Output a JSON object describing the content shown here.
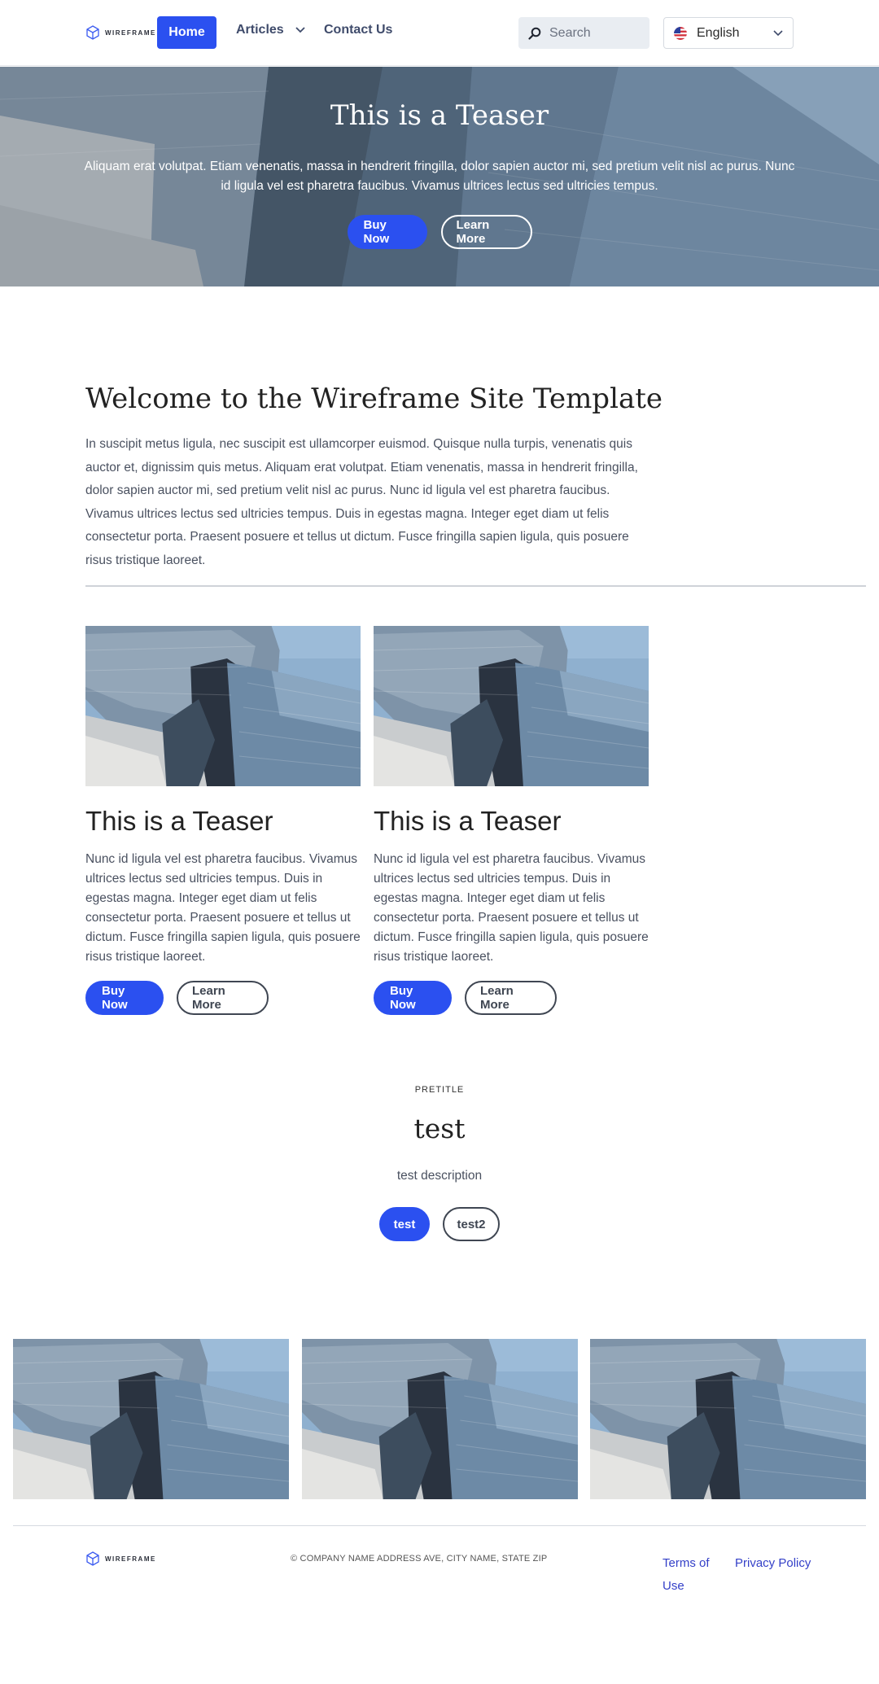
{
  "header": {
    "logo_text": "WIREFRAME",
    "nav": {
      "home": "Home",
      "articles": "Articles",
      "contact": "Contact Us"
    },
    "search_placeholder": "Search",
    "language": "English"
  },
  "hero": {
    "title": "This is a Teaser",
    "text": "Aliquam erat volutpat. Etiam venenatis, massa in hendrerit fringilla, dolor sapien auctor mi, sed pretium velit nisl ac purus. Nunc id ligula vel est pharetra faucibus. Vivamus ultrices lectus sed ultricies tempus.",
    "primary_button": "Buy Now",
    "secondary_button": "Learn More"
  },
  "welcome": {
    "title": "Welcome to the Wireframe Site Template",
    "text": "In suscipit metus ligula, nec suscipit est ullamcorper euismod. Quisque nulla turpis, venenatis quis auctor et, dignissim quis metus. Aliquam erat volutpat. Etiam venenatis, massa in hendrerit fringilla, dolor sapien auctor mi, sed pretium velit nisl ac purus. Nunc id ligula vel est pharetra faucibus. Vivamus ultrices lectus sed ultricies tempus. Duis in egestas magna. Integer eget diam ut felis consectetur porta. Praesent posuere et tellus ut dictum. Fusce fringilla sapien ligula, quis posuere risus tristique laoreet."
  },
  "cards": [
    {
      "title": "This is a Teaser",
      "text": "Nunc id ligula vel est pharetra faucibus. Vivamus ultrices lectus sed ultricies tempus. Duis in egestas magna. Integer eget diam ut felis consectetur porta. Praesent posuere et tellus ut dictum. Fusce fringilla sapien ligula, quis posuere risus tristique laoreet.",
      "primary_button": "Buy Now",
      "secondary_button": "Learn More"
    },
    {
      "title": "This is a Teaser",
      "text": "Nunc id ligula vel est pharetra faucibus. Vivamus ultrices lectus sed ultricies tempus. Duis in egestas magna. Integer eget diam ut felis consectetur porta. Praesent posuere et tellus ut dictum. Fusce fringilla sapien ligula, quis posuere risus tristique laoreet.",
      "primary_button": "Buy Now",
      "secondary_button": "Learn More"
    }
  ],
  "cta": {
    "pretitle": "PRETITLE",
    "title": "test",
    "description": "test description",
    "primary_button": "test",
    "secondary_button": "test2"
  },
  "footer": {
    "logo_text": "WIREFRAME",
    "address": "© COMPANY NAME ADDRESS AVE, CITY NAME, STATE ZIP",
    "terms_line1": "Terms of",
    "terms_line2": "Use",
    "privacy": "Privacy Policy"
  },
  "colors": {
    "primary": "#2b50f0",
    "link": "#3440c8",
    "text": "#4a5160",
    "heading": "#222222"
  }
}
